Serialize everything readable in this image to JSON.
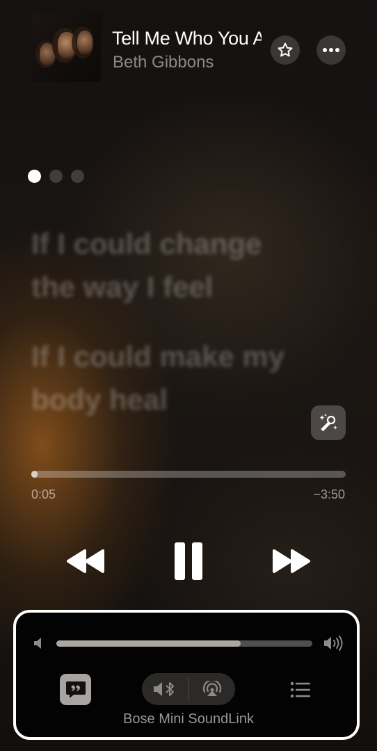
{
  "now_playing": {
    "title": "Tell Me Who You Are Today",
    "artist": "Beth Gibbons",
    "album_art": "album-cover"
  },
  "page_dots": {
    "count": 3,
    "active_index": 0
  },
  "lyrics": [
    "If I could change",
    "the way I feel",
    "If I could make my",
    "body heal"
  ],
  "playback": {
    "elapsed": "0:05",
    "remaining": "−3:50",
    "progress_fraction": 0.02
  },
  "controls": {
    "rewind_icon": "rewind-icon",
    "pause_icon": "pause-icon",
    "forward_icon": "fast-forward-icon"
  },
  "volume": {
    "level_fraction": 0.72
  },
  "bottom_bar": {
    "lyrics_icon": "lyrics-quote-icon",
    "bluetooth_icon": "speaker-bluetooth-icon",
    "airplay_icon": "airplay-audio-icon",
    "queue_icon": "queue-list-icon",
    "device_name": "Bose Mini SoundLink"
  },
  "colors": {
    "accent_outline": "#ffffff",
    "background_warm": "#a05f1e"
  }
}
